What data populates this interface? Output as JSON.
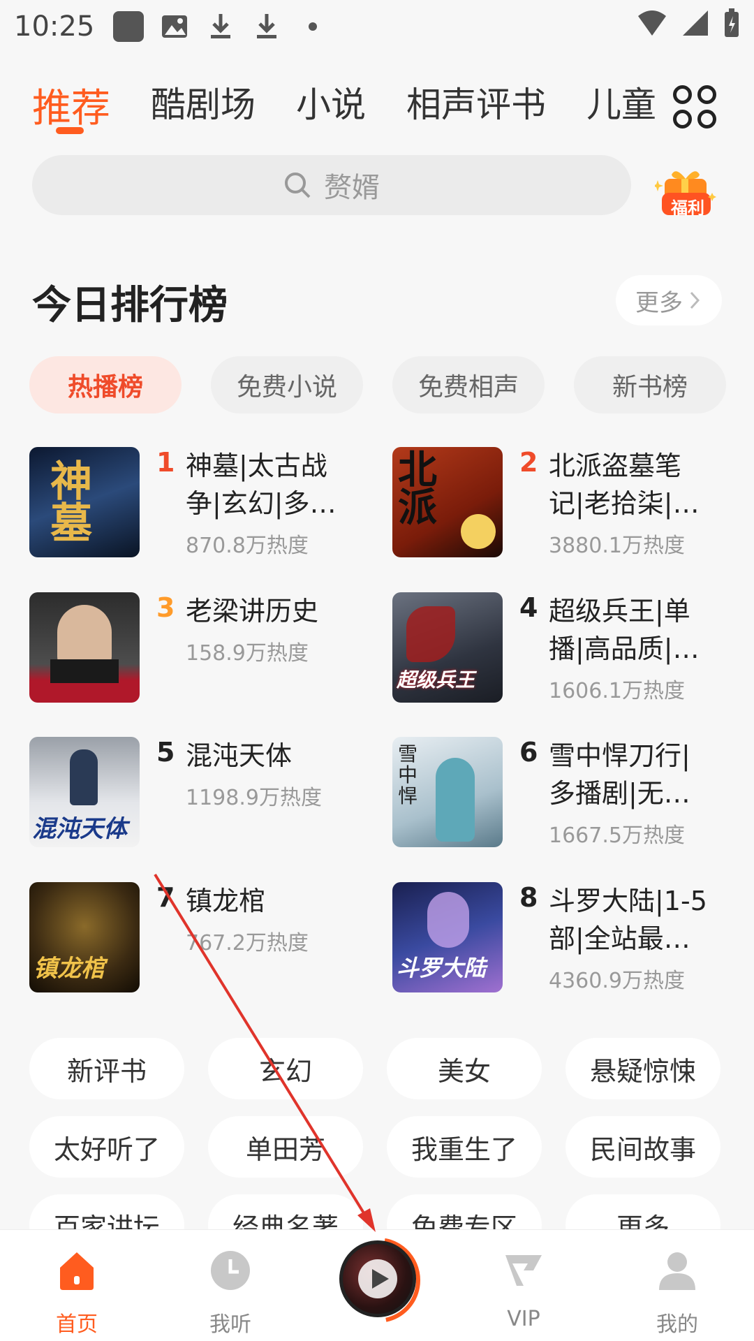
{
  "status_bar": {
    "time": "10:25"
  },
  "top_tabs": [
    {
      "label": "推荐",
      "active": true
    },
    {
      "label": "酷剧场",
      "active": false
    },
    {
      "label": "小说",
      "active": false
    },
    {
      "label": "相声评书",
      "active": false
    },
    {
      "label": "儿童",
      "active": false
    }
  ],
  "search": {
    "placeholder": "赘婿",
    "gift_label": "福利"
  },
  "ranking": {
    "title": "今日排行榜",
    "more_label": "更多",
    "tabs": [
      {
        "label": "热播榜",
        "active": true
      },
      {
        "label": "免费小说",
        "active": false
      },
      {
        "label": "免费相声",
        "active": false
      },
      {
        "label": "新书榜",
        "active": false
      }
    ],
    "items": [
      {
        "rank": "1",
        "title": "神墓|太古战争|玄幻|多…",
        "heat": "870.8万热度",
        "cover_color": "#1b2a4a"
      },
      {
        "rank": "2",
        "title": "北派盗墓笔记|老拾柒|…",
        "heat": "3880.1万热度",
        "cover_color": "#a8321c"
      },
      {
        "rank": "3",
        "title": "老梁讲历史",
        "heat": "158.9万热度",
        "cover_color": "#3a3a3a"
      },
      {
        "rank": "4",
        "title": "超级兵王|单播|高品质|…",
        "heat": "1606.1万热度",
        "cover_color": "#4a4e57"
      },
      {
        "rank": "5",
        "title": "混沌天体",
        "heat": "1198.9万热度",
        "cover_color": "#c9ccd3"
      },
      {
        "rank": "6",
        "title": "雪中悍刀行|多播剧|无…",
        "heat": "1667.5万热度",
        "cover_color": "#b9c7cf"
      },
      {
        "rank": "7",
        "title": "镇龙棺",
        "heat": "767.2万热度",
        "cover_color": "#3b2a12"
      },
      {
        "rank": "8",
        "title": "斗罗大陆|1-5部|全站最…",
        "heat": "4360.9万热度",
        "cover_color": "#2a3570"
      }
    ]
  },
  "tags": [
    "新评书",
    "玄幻",
    "美女",
    "悬疑惊悚",
    "太好听了",
    "单田芳",
    "我重生了",
    "民间故事",
    "百家讲坛",
    "经典名著",
    "免费专区",
    "更多"
  ],
  "bottom_nav": [
    {
      "label": "首页",
      "active": true
    },
    {
      "label": "我听",
      "active": false
    },
    {
      "label": "VIP",
      "active": false
    },
    {
      "label": "我的",
      "active": false
    }
  ],
  "colors": {
    "accent": "#ff5c1f",
    "rank_red": "#ef4b2a",
    "rank_orange": "#ff9b2a",
    "annotation_arrow": "#e0342b"
  }
}
